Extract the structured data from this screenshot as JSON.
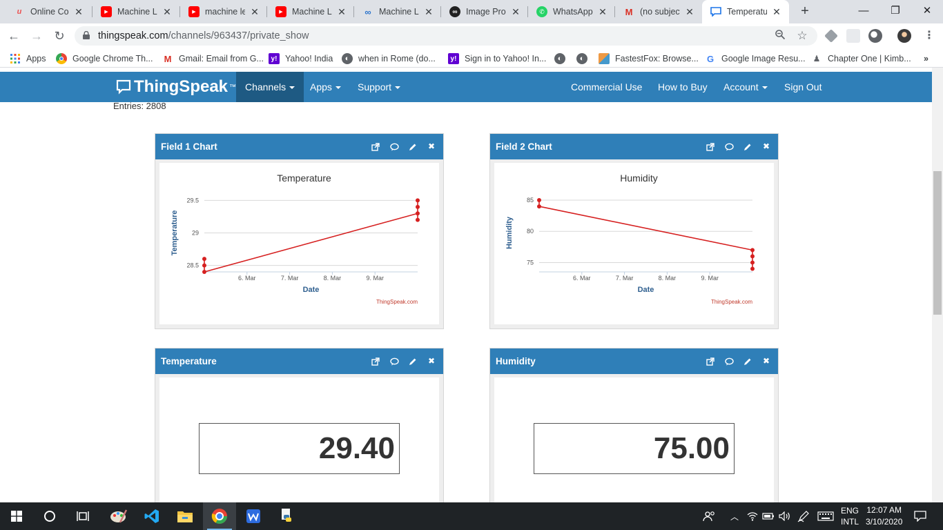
{
  "browser": {
    "tabs": [
      {
        "label": "Online Cou",
        "icon": "udemy-icon"
      },
      {
        "label": "Machine Le",
        "icon": "youtube-icon"
      },
      {
        "label": "machine lea",
        "icon": "youtube-icon"
      },
      {
        "label": "Machine Le",
        "icon": "youtube-icon"
      },
      {
        "label": "Machine Le",
        "icon": "coursera-icon"
      },
      {
        "label": "Image Proc",
        "icon": "infinity-icon"
      },
      {
        "label": "WhatsApp",
        "icon": "whatsapp-icon"
      },
      {
        "label": "(no subject",
        "icon": "gmail-icon"
      },
      {
        "label": "Temperatur",
        "icon": "thingspeak-icon"
      }
    ],
    "active_tab": 8,
    "url_host": "thingspeak.com",
    "url_path": "/channels/963437/private_show",
    "bookmarks": [
      {
        "label": "Apps",
        "icon": "apps-grid-icon"
      },
      {
        "label": "Google Chrome Th...",
        "icon": "chrome-icon"
      },
      {
        "label": "Gmail: Email from G...",
        "icon": "gmail-icon"
      },
      {
        "label": "Yahoo! India",
        "icon": "yahoo-icon"
      },
      {
        "label": "when in Rome (do...",
        "icon": "globe-icon"
      },
      {
        "label": "Sign in to Yahoo! In...",
        "icon": "yahoo-icon"
      },
      {
        "label": "",
        "icon": "globe-icon"
      },
      {
        "label": "",
        "icon": "globe-icon"
      },
      {
        "label": "FastestFox: Browse...",
        "icon": "fastestfox-icon"
      },
      {
        "label": "Google Image Resu...",
        "icon": "google-icon"
      },
      {
        "label": "Chapter One | Kimb...",
        "icon": "page-icon"
      }
    ],
    "more_bookmarks": "»"
  },
  "site": {
    "logo": "ThingSpeak",
    "logo_tm": "™",
    "nav_left": [
      "Channels",
      "Apps",
      "Support"
    ],
    "nav_right": [
      "Commercial Use",
      "How to Buy",
      "Account",
      "Sign Out"
    ]
  },
  "channel": {
    "entries_label": "Entries: 2808"
  },
  "panels": [
    {
      "title": "Field 1 Chart"
    },
    {
      "title": "Field 2 Chart"
    },
    {
      "title": "Temperature"
    },
    {
      "title": "Humidity"
    }
  ],
  "chart_data": [
    {
      "type": "line",
      "title": "Temperature",
      "xlabel": "Date",
      "ylabel": "Temperature",
      "credit": "ThingSpeak.com",
      "x_ticks": [
        "6. Mar",
        "7. Mar",
        "8. Mar",
        "9. Mar"
      ],
      "y_ticks": [
        "28.5",
        "29",
        "29.5"
      ],
      "ylim": [
        28.4,
        29.6
      ],
      "color": "#d62020",
      "points": [
        {
          "x": "5. Mar",
          "y": 28.6
        },
        {
          "x": "5. Mar",
          "y": 28.5
        },
        {
          "x": "5. Mar",
          "y": 28.4
        },
        {
          "x": "10. Mar",
          "y": 29.3
        },
        {
          "x": "10. Mar",
          "y": 29.2
        },
        {
          "x": "10. Mar",
          "y": 29.4
        },
        {
          "x": "10. Mar",
          "y": 29.5
        }
      ],
      "line": [
        {
          "x": "5. Mar",
          "y": 28.4
        },
        {
          "x": "10. Mar",
          "y": 29.3
        }
      ]
    },
    {
      "type": "line",
      "title": "Humidity",
      "xlabel": "Date",
      "ylabel": "Humidity",
      "credit": "ThingSpeak.com",
      "x_ticks": [
        "6. Mar",
        "7. Mar",
        "8. Mar",
        "9. Mar"
      ],
      "y_ticks": [
        "75",
        "80",
        "85"
      ],
      "ylim": [
        73.5,
        86
      ],
      "color": "#d62020",
      "points": [
        {
          "x": "5. Mar",
          "y": 85
        },
        {
          "x": "5. Mar",
          "y": 84
        },
        {
          "x": "10. Mar",
          "y": 77
        },
        {
          "x": "10. Mar",
          "y": 76
        },
        {
          "x": "10. Mar",
          "y": 75
        },
        {
          "x": "10. Mar",
          "y": 74
        }
      ],
      "line": [
        {
          "x": "5. Mar",
          "y": 84
        },
        {
          "x": "10. Mar",
          "y": 77
        }
      ]
    }
  ],
  "widgets": {
    "temperature_value": "29.40",
    "humidity_value": "75.00"
  },
  "taskbar": {
    "apps": [
      "windows-start-icon",
      "cortana-icon",
      "task-view-icon",
      "paint-icon",
      "vscode-icon",
      "file-explorer-icon",
      "chrome-icon",
      "wps-icon",
      "python-idle-icon"
    ],
    "lang_top": "ENG",
    "lang_bottom": "INTL",
    "time": "12:07 AM",
    "date": "3/10/2020"
  },
  "colors": {
    "brand": "#2f7fb8",
    "brand_dark": "#1e5a83",
    "series": "#d62020"
  }
}
